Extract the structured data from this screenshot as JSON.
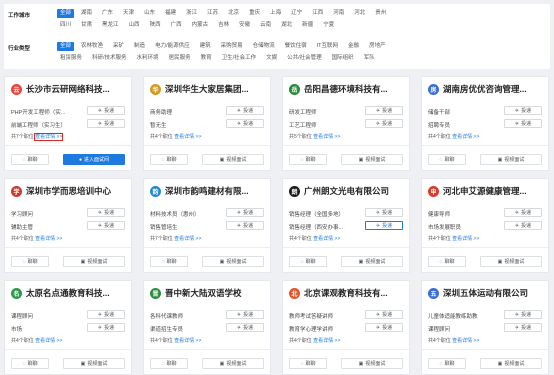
{
  "filters": {
    "city_label": "工作城市",
    "cities_row1": [
      "全部",
      "湖南",
      "广东",
      "天津",
      "山东",
      "福建",
      "浙江",
      "江苏",
      "北京",
      "重庆",
      "上海",
      "辽宁",
      "江西",
      "河南",
      "河北",
      "贵州"
    ],
    "cities_row2": [
      "四川",
      "甘肃",
      "黑龙江",
      "山西",
      "陕西",
      "广西",
      "内蒙古",
      "吉林",
      "安徽",
      "云南",
      "湖北",
      "新疆",
      "宁夏"
    ],
    "industry_label": "行业类型",
    "industries_row1": [
      "全部",
      "农林牧渔",
      "采矿",
      "制造",
      "电力/能源供应",
      "建筑",
      "采购贸易",
      "仓储物流",
      "餐饮住宿",
      "IT互联网",
      "金融",
      "房地产"
    ],
    "industries_row2": [
      "租赁服务",
      "科研/技术服务",
      "水利环境",
      "居民服务",
      "教育",
      "卫生/社会工作",
      "文娱",
      "公共/社会管理",
      "国际组织",
      "军队"
    ]
  },
  "common": {
    "tou": "投递",
    "chat": "聊聊",
    "video": "视频面试",
    "enter_room": "进入面试间",
    "more": "查看详情 >>"
  },
  "cards": [
    {
      "name": "长沙市云研网络科技...",
      "logo": "云",
      "color": "#e9463d",
      "jobs": [
        "PHP开发工程师（实...",
        "前端工程师（实习生）"
      ],
      "count": "共7个职位",
      "highlight": true,
      "btn2": "enter_room"
    },
    {
      "name": "深圳华生大家居集团...",
      "logo": "华",
      "color": "#d49a1f",
      "jobs": [
        "商务助理",
        "暂无生"
      ],
      "count": "共4个职位",
      "highlight": false,
      "btn2": "video"
    },
    {
      "name": "岳阳昌德环境科技有...",
      "logo": "岳",
      "color": "#2a8a3a",
      "jobs": [
        "研发工程师",
        "工艺工程师"
      ],
      "count": "共5个职位",
      "highlight": false,
      "btn2": "video"
    },
    {
      "name": "湖南房优优咨询管理...",
      "logo": "房",
      "color": "#3a6fd8",
      "jobs": [
        "储备干部",
        "招聘专员"
      ],
      "count": "共4个职位",
      "highlight": false,
      "btn2": "video"
    },
    {
      "name": "深圳市学而思培训中心",
      "logo": "学",
      "color": "#c9382f",
      "jobs": [
        "学习顾问",
        "辅助主管"
      ],
      "count": "共4个职位",
      "highlight": false,
      "btn2": "video"
    },
    {
      "name": "深圳市韵鸣建材有限...",
      "logo": "韵",
      "color": "#1f8ad6",
      "jobs": [
        "材料技术员（惠州）",
        "销售管培生"
      ],
      "count": "共7个职位",
      "highlight": false,
      "btn2": "video"
    },
    {
      "name": "广州朗文光电有限公司",
      "logo": "朗",
      "color": "#1b1b1b",
      "jobs": [
        "销售经理（全国多地）",
        "销售经理（西安办事..."
      ],
      "count": "共4个职位",
      "highlight": false,
      "btn2": "video",
      "tou_on": 1
    },
    {
      "name": "河北申艾源健康管理...",
      "logo": "申",
      "color": "#d93a2c",
      "jobs": [
        "健康导师",
        "市场发展职员"
      ],
      "count": "共4个职位",
      "highlight": false,
      "btn2": "video"
    },
    {
      "name": "太原名点通教育科技...",
      "logo": "名",
      "color": "#2d9a4a",
      "jobs": [
        "课程顾问",
        "市场"
      ],
      "count": "共4个职位",
      "highlight": false,
      "btn2": "video"
    },
    {
      "name": "晋中新大陆双语学校",
      "logo": "晋",
      "color": "#2b8f3e",
      "jobs": [
        "各科代课教师",
        "渠道招生专员"
      ],
      "count": "共4个职位",
      "highlight": false,
      "btn2": "video"
    },
    {
      "name": "北京课观教育科技有...",
      "logo": "北",
      "color": "#e2572a",
      "jobs": [
        "教师考试答疑讲师",
        "教育学心理学讲师"
      ],
      "count": "共4个职位",
      "highlight": false,
      "btn2": "video"
    },
    {
      "name": "深圳五体运动有限公司",
      "logo": "五",
      "color": "#3a6fd8",
      "jobs": [
        "儿童体适能教练助教",
        "课程顾问"
      ],
      "count": "共4个职位",
      "highlight": false,
      "btn2": "video"
    }
  ]
}
